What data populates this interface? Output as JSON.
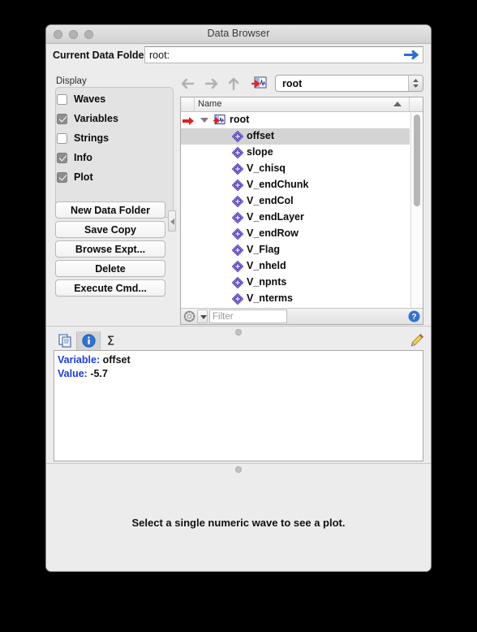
{
  "window": {
    "title": "Data Browser",
    "traffic_lights": [
      "close-button",
      "minimize-button",
      "zoom-button"
    ]
  },
  "current_data_folder": {
    "label": "Current Data Folder:",
    "value": "root:",
    "go_icon": "blue-right-arrow-icon"
  },
  "display_panel": {
    "title": "Display",
    "checkboxes": [
      {
        "label": "Waves",
        "checked": false
      },
      {
        "label": "Variables",
        "checked": true
      },
      {
        "label": "Strings",
        "checked": false
      },
      {
        "label": "Info",
        "checked": true
      },
      {
        "label": "Plot",
        "checked": true
      }
    ],
    "buttons": [
      "New Data Folder",
      "Save Copy",
      "Browse Expt...",
      "Delete",
      "Execute Cmd..."
    ]
  },
  "navbar": {
    "back_icon": "back-arrow-icon",
    "forward_icon": "forward-arrow-icon",
    "up_icon": "up-arrow-icon",
    "folder_icon": "data-folder-icon",
    "combo_value": "root"
  },
  "tree": {
    "column_header": "Name",
    "sort_indicator": "ascending",
    "root": {
      "label": "root",
      "expanded": true,
      "marker": "red-arrow-icon",
      "icon": "data-folder-icon"
    },
    "items": [
      {
        "label": "offset",
        "selected": true,
        "icon": "variable-icon"
      },
      {
        "label": "slope",
        "selected": false,
        "icon": "variable-icon"
      },
      {
        "label": "V_chisq",
        "selected": false,
        "icon": "variable-icon"
      },
      {
        "label": "V_endChunk",
        "selected": false,
        "icon": "variable-icon"
      },
      {
        "label": "V_endCol",
        "selected": false,
        "icon": "variable-icon"
      },
      {
        "label": "V_endLayer",
        "selected": false,
        "icon": "variable-icon"
      },
      {
        "label": "V_endRow",
        "selected": false,
        "icon": "variable-icon"
      },
      {
        "label": "V_Flag",
        "selected": false,
        "icon": "variable-icon"
      },
      {
        "label": "V_nheld",
        "selected": false,
        "icon": "variable-icon"
      },
      {
        "label": "V_npnts",
        "selected": false,
        "icon": "variable-icon"
      },
      {
        "label": "V_nterms",
        "selected": false,
        "icon": "variable-icon"
      }
    ],
    "filter": {
      "gear_icon": "gear-icon",
      "dropdown_icon": "chevron-down-icon",
      "placeholder": "Filter",
      "value": "",
      "help_icon": "help-icon"
    }
  },
  "info_pane": {
    "tabs": [
      {
        "name": "copy-icon",
        "active": false
      },
      {
        "name": "info-icon",
        "active": true
      },
      {
        "name": "sigma-icon",
        "active": false
      }
    ],
    "edit_icon": "pencil-icon",
    "lines": [
      {
        "key": "Variable:",
        "value": "offset"
      },
      {
        "key": "Value:",
        "value": "-5.7"
      }
    ]
  },
  "plot_pane": {
    "message": "Select a single numeric wave to see a plot."
  },
  "colors": {
    "accent_blue": "#2a6fd6",
    "label_blue": "#1a3ce8",
    "selection_gray": "#d4d4d4",
    "window_bg": "#ececec"
  }
}
